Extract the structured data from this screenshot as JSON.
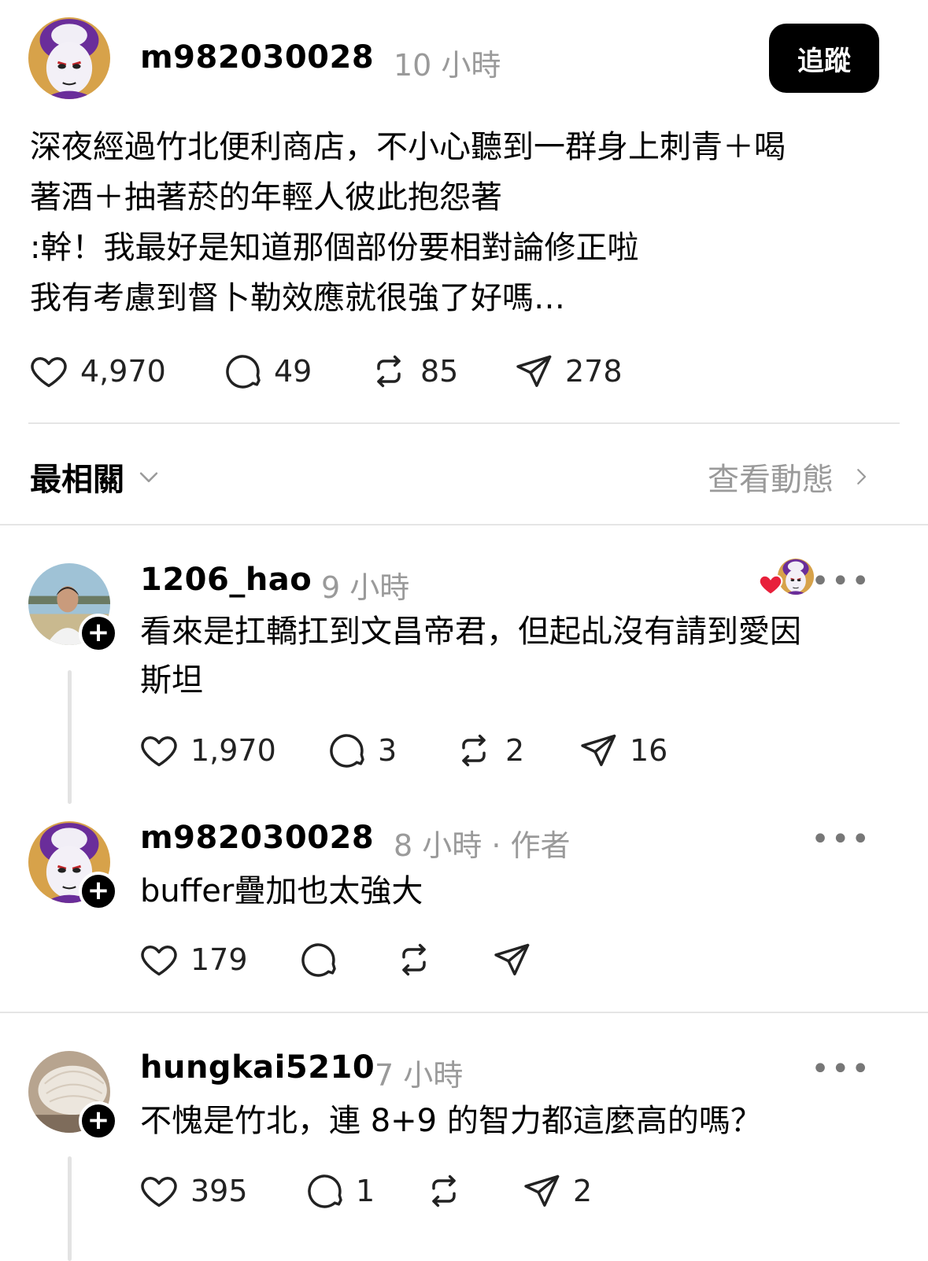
{
  "post": {
    "username": "m982030028",
    "time": "10 小時",
    "follow_label": "追蹤",
    "lines": [
      "深夜經過竹北便利商店，不小心聽到一群身上刺青＋喝",
      "著酒＋抽著菸的年輕人彼此抱怨著",
      ":幹！我最好是知道那個部份要相對論修正啦",
      "我有考慮到督卜勒效應就很強了好嗎…"
    ],
    "likes": "4,970",
    "comments": "49",
    "reposts": "85",
    "shares": "278"
  },
  "sort": {
    "label": "最相關",
    "activity_label": "查看動態"
  },
  "replies": [
    {
      "username": "1206_hao",
      "time": "9 小時",
      "lines": [
        "看來是扛轎扛到文昌帝君，但起乩沒有請到愛因",
        "斯坦"
      ],
      "likes": "1,970",
      "comments": "3",
      "reposts": "2",
      "shares": "16"
    },
    {
      "username": "m982030028",
      "time": "8 小時 · 作者",
      "lines": [
        "buffer疊加也太強大"
      ],
      "likes": "179"
    },
    {
      "username": "hungkai5210",
      "time": "7 小時",
      "lines": [
        "不愧是竹北，連 8+9 的智力都這麼高的嗎？"
      ],
      "likes": "395",
      "comments": "1",
      "shares": "2"
    }
  ],
  "icons": {
    "like": "heart-icon",
    "comment": "comment-bubble-icon",
    "repost": "repost-icon",
    "share": "send-icon",
    "more": "more-dots-icon",
    "liked_by_author": "liked-by-author-heart-icon"
  },
  "colors": {
    "secondary_text": "#9a9a9a",
    "liked_heart": "#e8203b"
  }
}
